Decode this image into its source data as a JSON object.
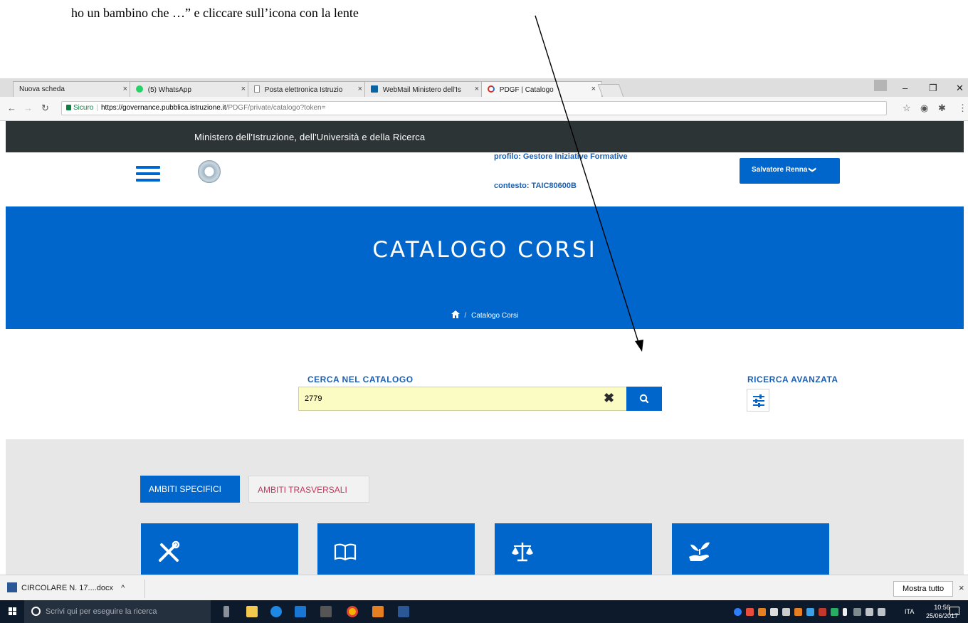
{
  "caption": "ho un bambino che …” e cliccare sull’icona con la lente",
  "browser": {
    "tabs": [
      {
        "label": "Nuova scheda",
        "icon": "blank-page-icon"
      },
      {
        "label": "(5) WhatsApp",
        "icon": "whatsapp-icon"
      },
      {
        "label": "Posta elettronica Istruzio",
        "icon": "document-icon"
      },
      {
        "label": "WebMail Ministero dell'Is",
        "icon": "webmail-icon"
      },
      {
        "label": "PDGF | Catalogo",
        "icon": "loading-icon"
      }
    ],
    "close_glyph": "×",
    "secure_label": "Sicuro",
    "url_host": "https://governance.pubblica.istruzione.it",
    "url_path": "/PDGF/private/catalogo?token="
  },
  "site": {
    "ministry_title": "Ministero dell'Istruzione, dell'Università e della Ricerca",
    "profile_label": "profilo: Gestore Iniziative Formative",
    "contesto_label": "contesto: TAIC80600B",
    "user_name": "Salvatore Renna",
    "user_chevron": "❯"
  },
  "hero": {
    "title": "CATALOGO CORSI",
    "breadcrumb_sep": "/",
    "breadcrumb_current": "Catalogo Corsi"
  },
  "search": {
    "label": "CERCA NEL CATALOGO",
    "value": "2779",
    "clear_glyph": "✖",
    "advanced_label": "RICERCA AVANZATA"
  },
  "ambiti": {
    "specific_label": "AMBITI SPECIFICI",
    "transversal_label": "AMBITI TRASVERSALI",
    "cards": [
      {
        "icon": "tools-icon"
      },
      {
        "icon": "open-book-icon"
      },
      {
        "icon": "balance-scale-icon"
      },
      {
        "icon": "hand-plant-icon"
      }
    ]
  },
  "downloads": {
    "file_name": "CIRCOLARE N. 17....docx",
    "caret": "^",
    "show_all": "Mostra tutto",
    "close_glyph": "×"
  },
  "taskbar": {
    "search_placeholder": "Scrivi qui per eseguire la ricerca",
    "language": "ITA",
    "time": "10:56",
    "date": "25/06/2017"
  },
  "colors": {
    "primary_blue": "#0066cc",
    "ministry_bar": "#2d3436",
    "search_bg": "#fbfbc4",
    "transversal_text": "#c1395c"
  }
}
